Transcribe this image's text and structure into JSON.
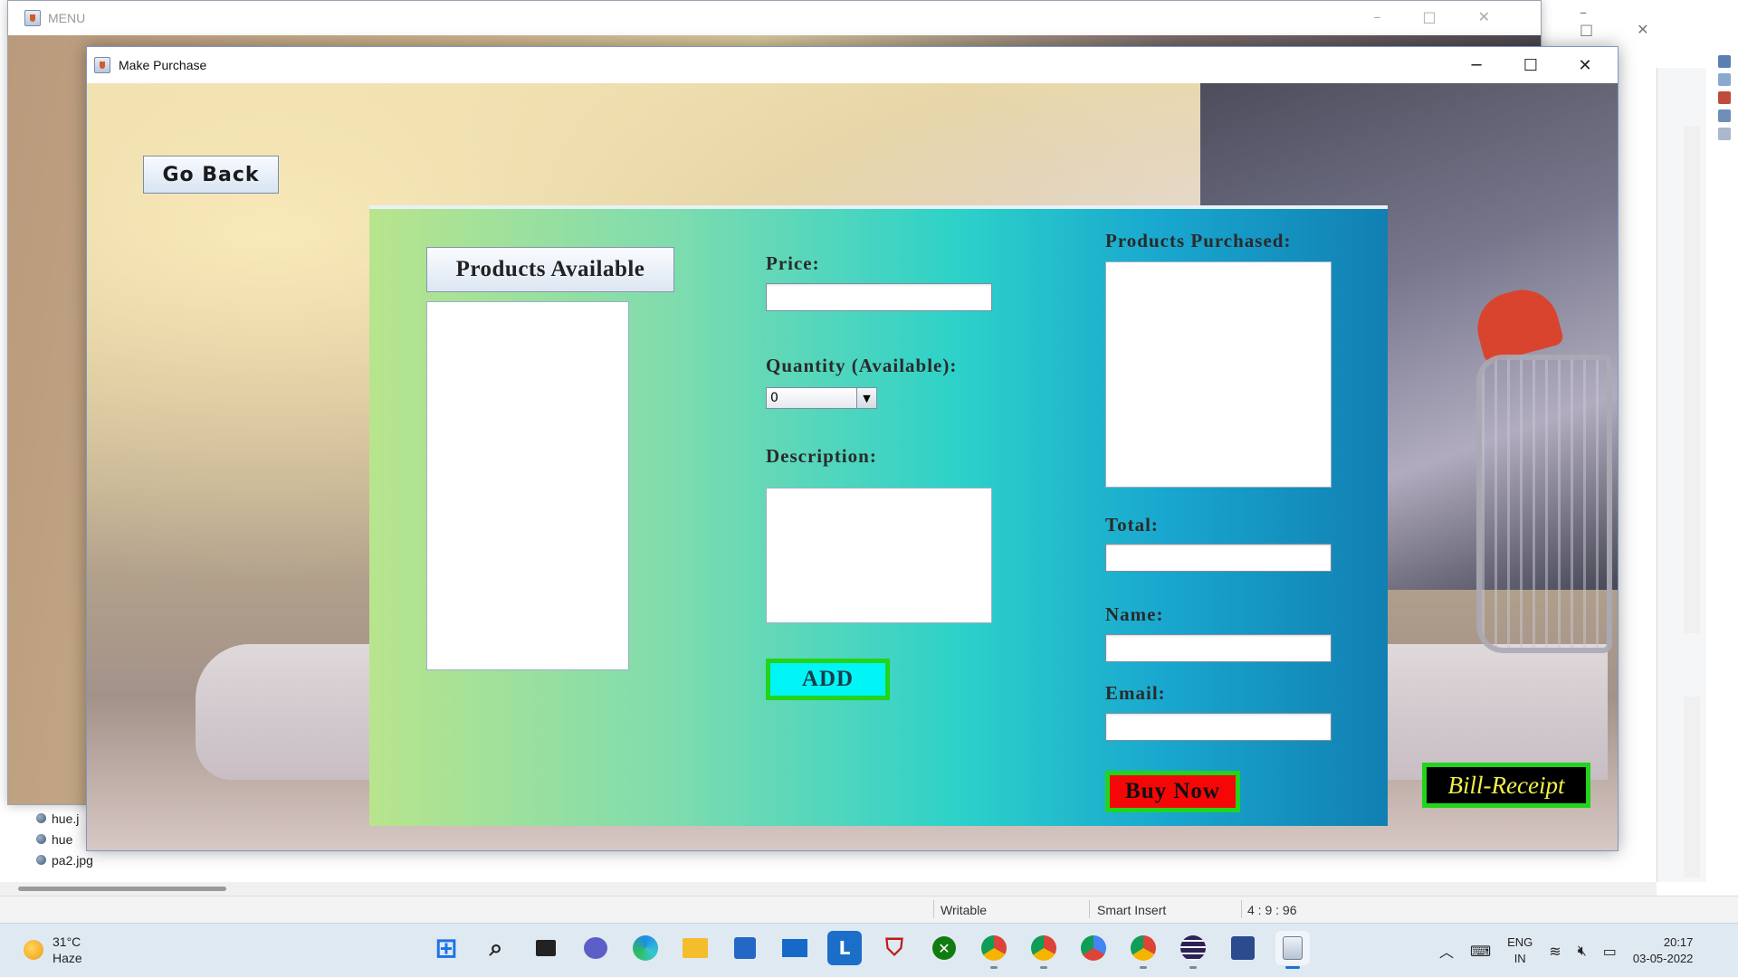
{
  "menu_window": {
    "title": "MENU",
    "controls": [
      "minimize-icon",
      "maximize-icon",
      "close-icon"
    ]
  },
  "purchase_window": {
    "title": "Make Purchase",
    "go_back_label": "Go Back",
    "products_available_label": "Products Available",
    "price_label": "Price:",
    "price_value": "",
    "quantity_label": "Quantity (Available):",
    "quantity_selected": "0",
    "description_label": "Description:",
    "add_label": "ADD",
    "products_purchased_label": "Products Purchased:",
    "total_label": "Total:",
    "total_value": "",
    "name_label": "Name:",
    "name_value": "",
    "email_label": "Email:",
    "email_value": "",
    "buy_now_label": "Buy Now",
    "bill_receipt_label": "Bill-Receipt",
    "colors": {
      "add_button": "#00f6f6",
      "buy_now_button": "#f50707",
      "bill_receipt_button": "#000000",
      "bill_receipt_text": "#f2ef4a",
      "button_border": "#22d41c"
    }
  },
  "ide_files": [
    "hue.j",
    "hue",
    "pa2.jpg"
  ],
  "status_bar": {
    "writable": "Writable",
    "insert_mode": "Smart Insert",
    "position": "4 : 9 : 96"
  },
  "taskbar": {
    "weather_temp": "31°C",
    "weather_desc": "Haze",
    "apps": [
      "start-icon",
      "search-icon",
      "task-view-icon",
      "chat-icon",
      "edge-icon",
      "file-explorer-icon",
      "store-icon",
      "mail-icon",
      "l-app-icon",
      "mcafee-icon",
      "xbox-icon",
      "chrome-icon",
      "chrome-profile-icon",
      "chrome-profile-2-icon",
      "chrome-profile-3-icon",
      "eclipse-icon",
      "snipping-tool-icon",
      "java-app-icon"
    ],
    "language_top": "ENG",
    "language_bottom": "IN",
    "time": "20:17",
    "date": "03-05-2022"
  }
}
